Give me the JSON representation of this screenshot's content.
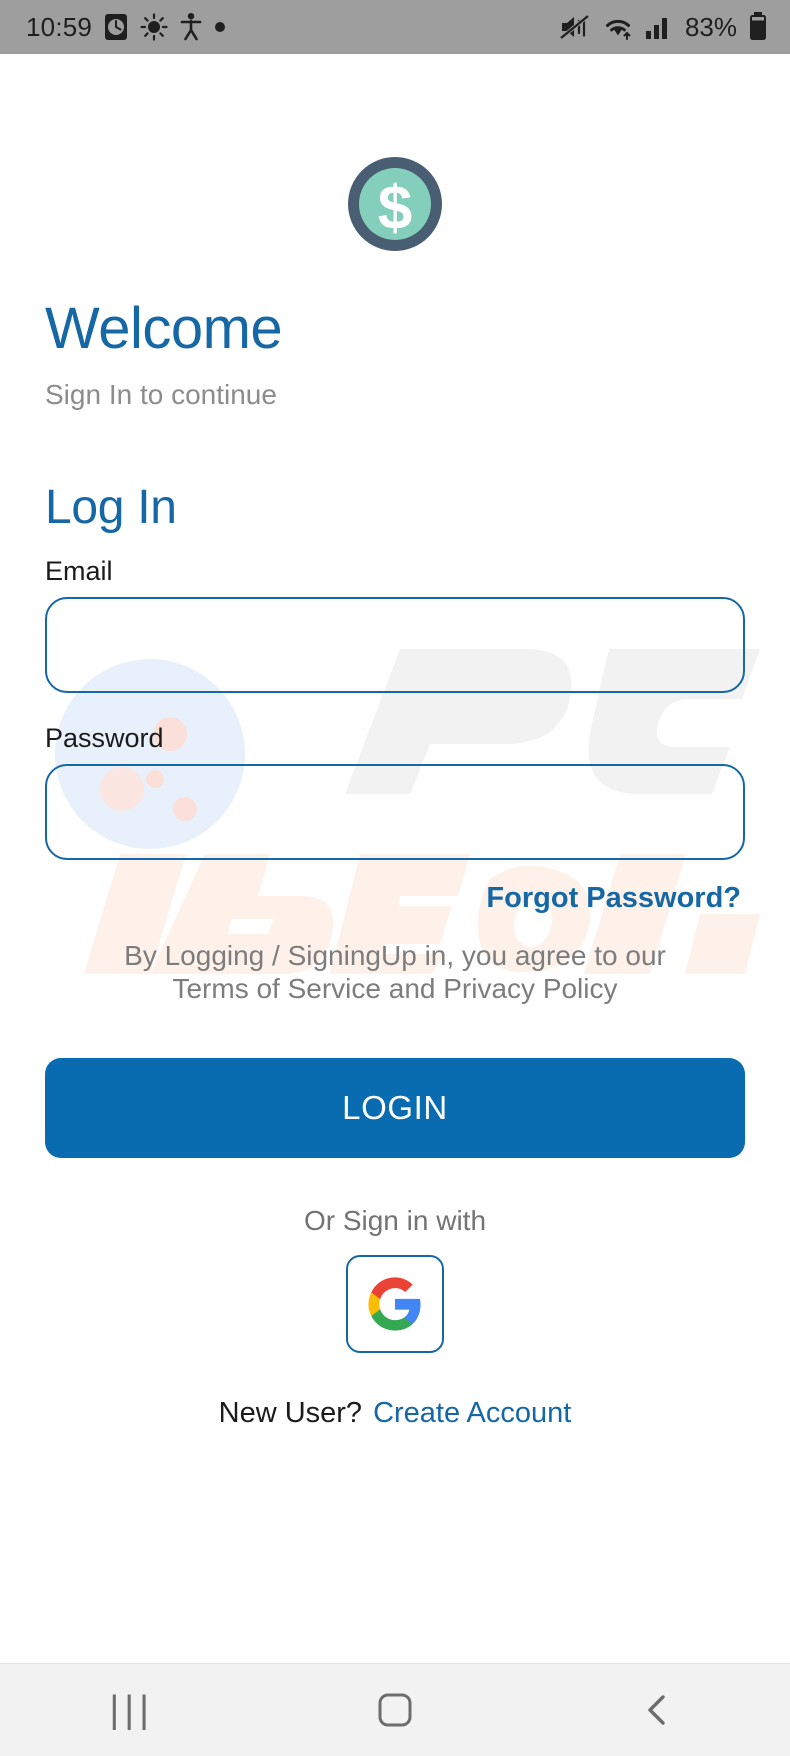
{
  "status_bar": {
    "time": "10:59",
    "battery_percent": "83%",
    "left_icons": [
      "alarm-clock-icon",
      "brightness-icon",
      "accessibility-icon",
      "dot-icon"
    ],
    "right_icons": [
      "mute-icon",
      "wifi-icon",
      "signal-bars-icon",
      "battery-icon"
    ],
    "bg_color": "#9e9e9e"
  },
  "logo": {
    "name": "dollar-coin-logo",
    "ring_color": "#4a5e73",
    "inner_color": "#83cfbb",
    "symbol": "$",
    "symbol_color": "#ffffff"
  },
  "header": {
    "welcome_title": "Welcome",
    "subtitle": "Sign In to continue",
    "title_color": "#1568a5"
  },
  "form": {
    "heading": "Log In",
    "email": {
      "label": "Email",
      "value": "",
      "placeholder": ""
    },
    "password": {
      "label": "Password",
      "value": "",
      "placeholder": ""
    },
    "forgot_password_label": "Forgot Password?",
    "terms_line1": "By Logging / SigningUp in, you agree to our",
    "terms_line2": "Terms of Service and Privacy Policy",
    "border_color": "#1568a5"
  },
  "actions": {
    "login_label": "LOGIN",
    "login_bg": "#0a6cb0",
    "or_sign_in_label": "Or Sign in with",
    "google_icon_name": "google-g-icon",
    "new_user_label": "New User?",
    "create_account_label": "Create Account"
  },
  "watermark": {
    "text_pc": "PC",
    "text_risk": "risk.com"
  },
  "nav_bar": {
    "recents_glyph": "|||",
    "home_name": "home-button",
    "back_name": "back-button"
  }
}
